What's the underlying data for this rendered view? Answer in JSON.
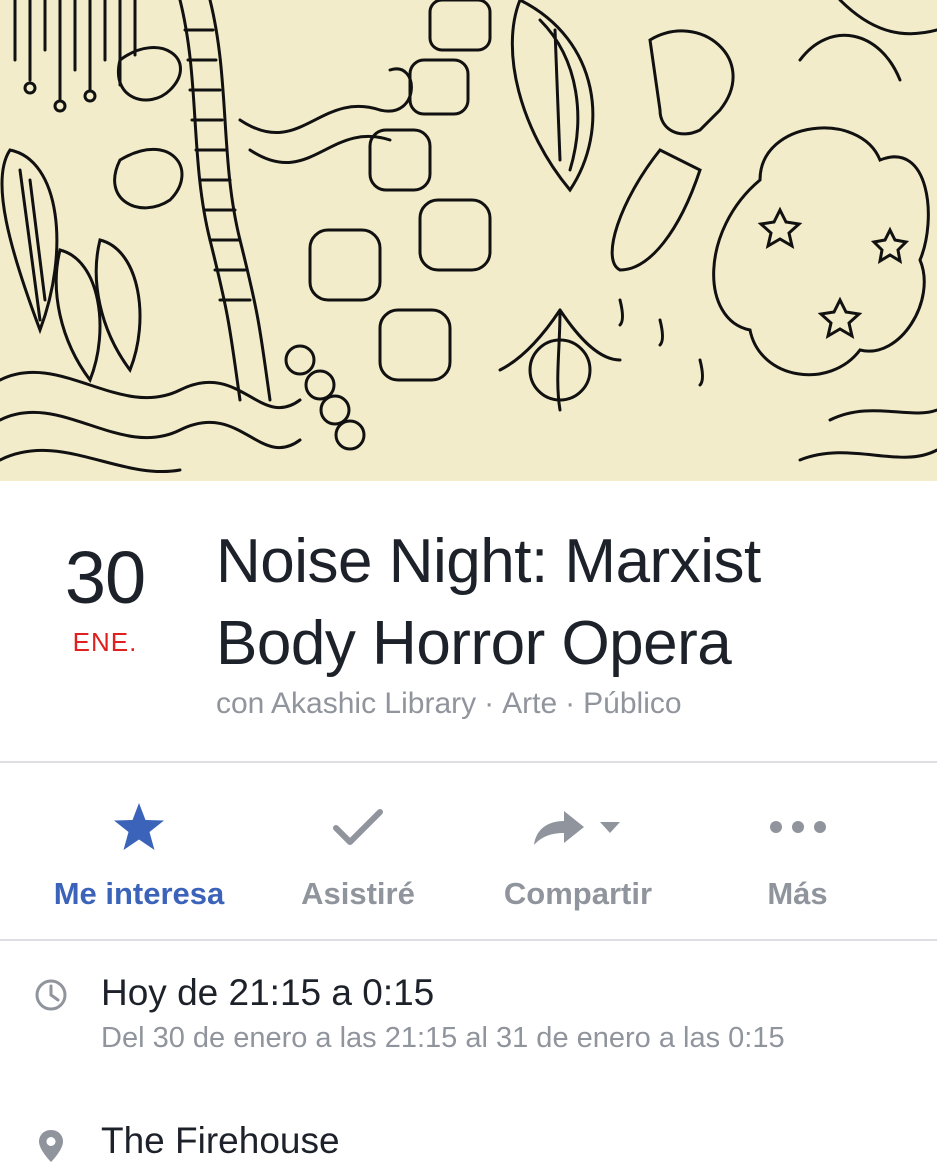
{
  "event": {
    "cover_image": "hand-drawn ink doodle artwork",
    "day": "30",
    "month": "ENE.",
    "title_line1": "Noise Night: Marxist",
    "title_line2": "Body Horror Opera",
    "host_prefix": "con Akashic Library",
    "category": "Arte",
    "privacy": "Público",
    "separator": "·"
  },
  "actions": [
    {
      "label": "Me interesa",
      "icon": "star-icon",
      "active": true
    },
    {
      "label": "Asistiré",
      "icon": "check-icon",
      "active": false
    },
    {
      "label": "Compartir",
      "icon": "share-arrow-icon",
      "active": false
    },
    {
      "label": "Más",
      "icon": "more-dots-icon",
      "active": false
    }
  ],
  "details": {
    "time_main": "Hoy de 21:15 a 0:15",
    "time_sub": "Del 30 de enero a las 21:15 al 31 de enero a las 0:15",
    "location": "The Firehouse"
  },
  "colors": {
    "accent": "#3b63ba",
    "date_red": "#e0201f",
    "muted_text": "#90949c",
    "divider": "#dddfe2",
    "cover_bg": "#f3eccb"
  }
}
